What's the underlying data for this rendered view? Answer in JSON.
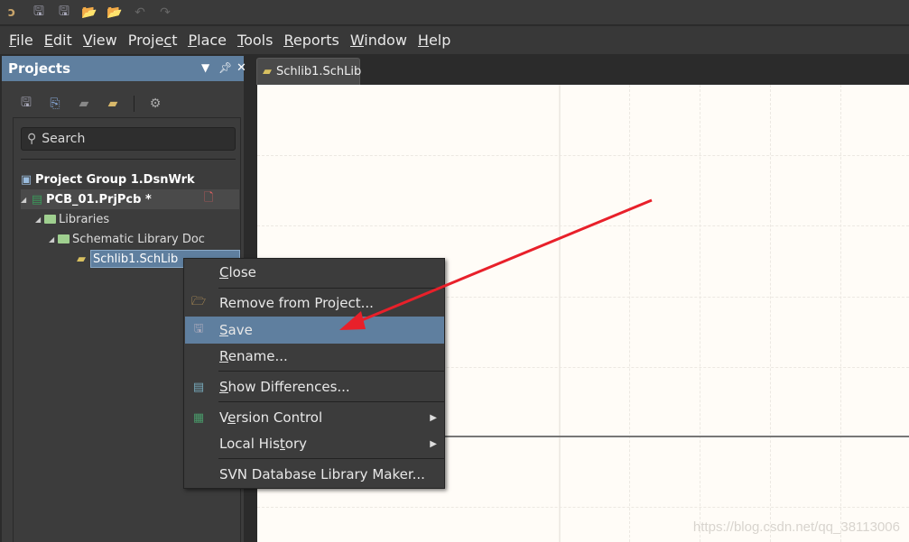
{
  "toolbar": {
    "icons": [
      "app-logo",
      "save-icon",
      "save-all-icon",
      "open-icon",
      "open-project-icon",
      "undo-icon",
      "redo-icon"
    ]
  },
  "menubar": [
    {
      "label": "File",
      "accel": 0
    },
    {
      "label": "Edit",
      "accel": 0
    },
    {
      "label": "View",
      "accel": 0
    },
    {
      "label": "Project",
      "accel": 5
    },
    {
      "label": "Place",
      "accel": 0
    },
    {
      "label": "Tools",
      "accel": 0
    },
    {
      "label": "Reports",
      "accel": 0
    },
    {
      "label": "Window",
      "accel": 0
    },
    {
      "label": "Help",
      "accel": 0
    }
  ],
  "panel": {
    "title": "Projects",
    "search_placeholder": "Search",
    "tree": {
      "group": "Project Group 1.DsnWrk",
      "project": "PCB_01.PrjPcb *",
      "libraries": "Libraries",
      "schlibdoc": "Schematic Library Doc",
      "file": "Schlib1.SchLib"
    }
  },
  "tabs": [
    {
      "label": "Schlib1.SchLib",
      "active": true
    }
  ],
  "context_menu": [
    {
      "label": "Close",
      "accel": 0
    },
    {
      "label": "Remove from Project...",
      "accel": -1,
      "icon": "folder-remove-icon"
    },
    {
      "label": "Save",
      "accel": 0,
      "icon": "save-icon",
      "highlighted": true
    },
    {
      "label": "Rename...",
      "accel": 0
    },
    {
      "label": "Show Differences...",
      "accel": 0,
      "icon": "differences-icon"
    },
    {
      "label": "Version Control",
      "accel": 1,
      "icon": "version-control-icon",
      "submenu": true
    },
    {
      "label": "Local History",
      "accel": 9,
      "submenu": true
    },
    {
      "label": "SVN Database Library Maker...",
      "accel": -1
    }
  ],
  "watermark": "https://blog.csdn.net/qq_38113006",
  "colors": {
    "accent": "#5f7f9f",
    "annotation_arrow": "#e8202a",
    "canvas": "#fffcf7"
  }
}
